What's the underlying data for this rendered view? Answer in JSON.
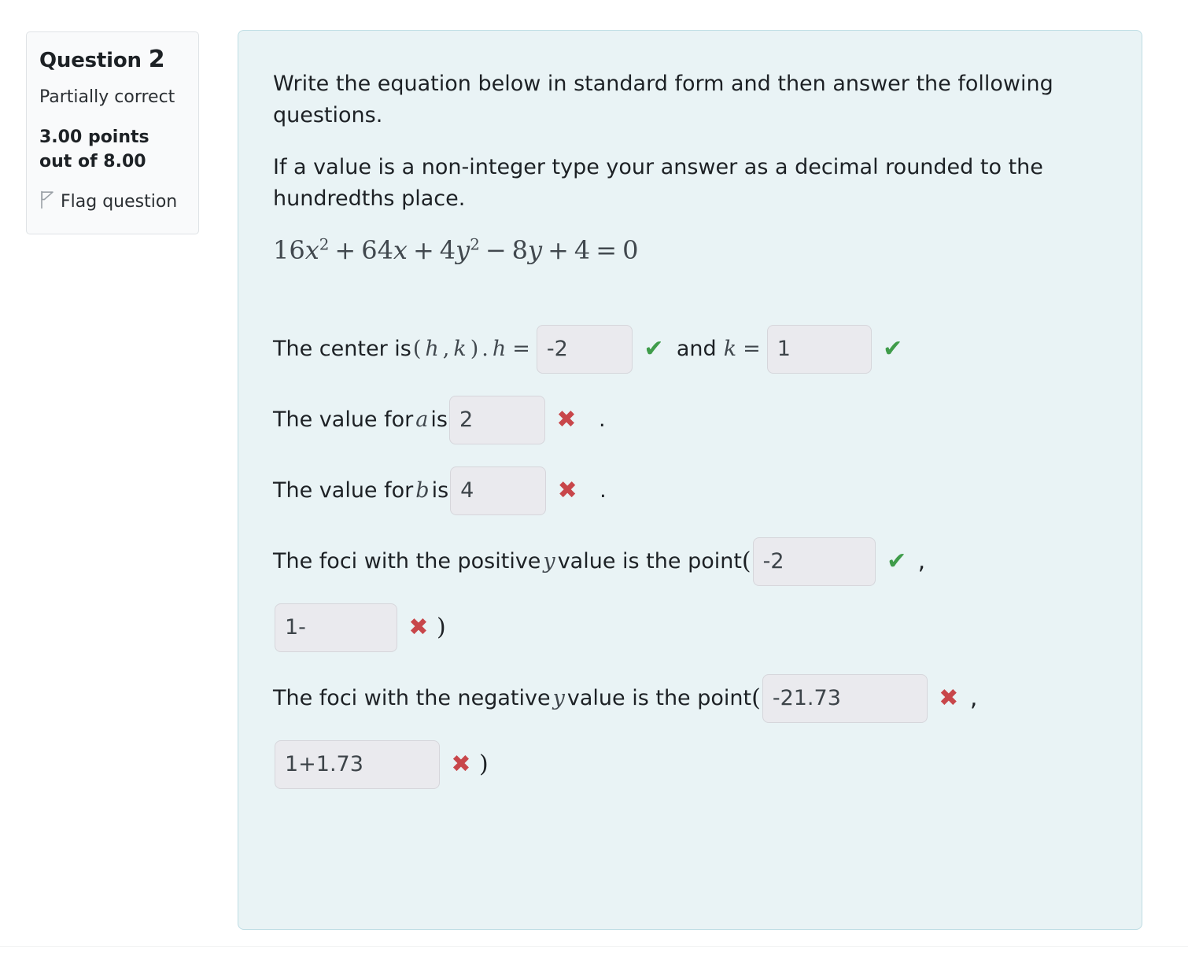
{
  "sidebar": {
    "question_label": "Question",
    "question_number": "2",
    "state": "Partially correct",
    "grade": "3.00 points out of 8.00",
    "flag_label": "Flag question",
    "flag_icon": "flag-outline-icon"
  },
  "panel": {
    "background_color": "#e9f3f5",
    "border_color": "#bedde4",
    "prompt_line_1": "Write the equation below in standard form and then answer the following questions.",
    "prompt_line_2": "If a value is a non-integer type your answer as a decimal rounded to the hundredths place.",
    "equation": {
      "term_1_coef": "16",
      "term_1_var": "x",
      "term_1_exp": "2",
      "op_1": "+",
      "term_2_coef": "64",
      "term_2_var": "x",
      "op_2": "+",
      "term_3_coef": "4",
      "term_3_var": "y",
      "term_3_exp": "2",
      "op_3": "−",
      "term_4_coef": "8",
      "term_4_var": "y",
      "op_4": "+",
      "term_5": "4",
      "equals": "=",
      "rhs": "0",
      "plain": "16x^2 + 64x + 4y^2 - 8y + 4 = 0"
    },
    "rows": [
      {
        "id": "center",
        "text_before": "The center is",
        "pair_open": "(",
        "pair_h": "h",
        "pair_comma": ",",
        "pair_k": "k",
        "pair_close": ")",
        "pair_period": ".",
        "label_h": "h",
        "equals_h": "=",
        "value_h": "-2",
        "mark_h": "correct",
        "mark_h_glyph": "✔",
        "conjunction": "and",
        "label_k": "k",
        "equals_k": "=",
        "value_k": "1",
        "mark_k": "correct",
        "mark_k_glyph": "✔"
      },
      {
        "id": "value-a",
        "text_before": "The value for",
        "var": "a",
        "text_after": "is",
        "value": "2",
        "mark": "wrong",
        "mark_glyph": "✖",
        "trailing": "."
      },
      {
        "id": "value-b",
        "text_before": "The value for",
        "var": "b",
        "text_after": "is",
        "value": "4",
        "mark": "wrong",
        "mark_glyph": "✖",
        "trailing": "."
      },
      {
        "id": "foci-positive",
        "text_before": "The foci with the positive",
        "var": "y",
        "text_after": "value is the point",
        "open_paren": "(",
        "value_x": "-2",
        "mark_x": "correct",
        "mark_x_glyph": "✔",
        "comma": ",",
        "value_y": "1-",
        "mark_y": "wrong",
        "mark_y_glyph": "✖",
        "close_paren": ")"
      },
      {
        "id": "foci-negative",
        "text_before": "The foci with the negative",
        "var": "y",
        "text_after": "value is the point",
        "open_paren": "(",
        "value_x": "-21.73",
        "mark_x": "wrong",
        "mark_x_glyph": "✖",
        "comma": ",",
        "value_y": "1+1.73",
        "mark_y": "wrong",
        "mark_y_glyph": "✖",
        "close_paren": ")"
      }
    ]
  },
  "colors": {
    "correct": "#3f9c4a",
    "wrong": "#c8464a",
    "input_background": "#eaeaee",
    "input_border": "#d6d6db",
    "text": "#1d2125"
  }
}
